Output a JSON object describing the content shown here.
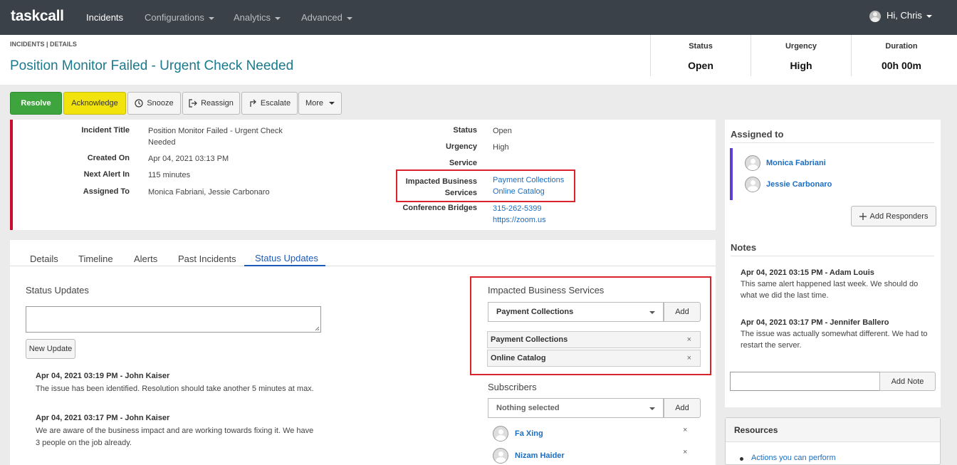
{
  "app": {
    "brand": "taskcall"
  },
  "nav": {
    "items": [
      {
        "label": "Incidents",
        "active": true
      },
      {
        "label": "Configurations",
        "dropdown": true
      },
      {
        "label": "Analytics",
        "dropdown": true
      },
      {
        "label": "Advanced",
        "dropdown": true
      }
    ],
    "user_greeting": "Hi, Chris"
  },
  "header": {
    "breadcrumb": "INCIDENTS | DETAILS",
    "title": "Position Monitor Failed - Urgent Check Needed",
    "stats": [
      {
        "label": "Status",
        "value": "Open"
      },
      {
        "label": "Urgency",
        "value": "High"
      },
      {
        "label": "Duration",
        "value": "00h 00m"
      }
    ]
  },
  "actions": {
    "resolve": "Resolve",
    "acknowledge": "Acknowledge",
    "snooze": "Snooze",
    "reassign": "Reassign",
    "escalate": "Escalate",
    "more": "More"
  },
  "details": {
    "incident_title_label": "Incident Title",
    "incident_title_line1": "Position Monitor Failed - Urgent Check",
    "incident_title_line2": "Needed",
    "created_on_label": "Created On",
    "created_on": "Apr 04, 2021 03:13 PM",
    "next_alert_label": "Next Alert In",
    "next_alert": "115 minutes",
    "assigned_to_label": "Assigned To",
    "assigned_to": "Monica Fabriani, Jessie Carbonaro",
    "status_label": "Status",
    "status": "Open",
    "urgency_label": "Urgency",
    "urgency": "High",
    "service_label": "Service",
    "impacted_label_line1": "Impacted Business",
    "impacted_label_line2": "Services",
    "impacted_services": [
      "Payment Collections",
      "Online Catalog"
    ],
    "conference_label": "Conference Bridges",
    "conference_phone": "315-262-5399",
    "conference_url": "https://zoom.us"
  },
  "tabs": [
    {
      "label": "Details"
    },
    {
      "label": "Timeline"
    },
    {
      "label": "Alerts"
    },
    {
      "label": "Past Incidents"
    },
    {
      "label": "Status Updates",
      "active": true
    }
  ],
  "status_updates": {
    "title": "Status Updates",
    "new_update_button": "New Update",
    "entries": [
      {
        "head": "Apr 04, 2021 03:19 PM - John Kaiser",
        "body_line1": "The issue has been identified. Resolution should take another 5 minutes at max.",
        "body_line2": ""
      },
      {
        "head": "Apr 04, 2021 03:17 PM - John Kaiser",
        "body_line1": "We are aware of the business impact and are working towards fixing it. We have",
        "body_line2": "3 people on the job already."
      }
    ]
  },
  "impacted_panel": {
    "title": "Impacted Business Services",
    "selected": "Payment Collections",
    "add_button": "Add",
    "chips": [
      "Payment Collections",
      "Online Catalog"
    ],
    "remove_glyph": "×"
  },
  "subscribers": {
    "title": "Subscribers",
    "placeholder": "Nothing selected",
    "add_button": "Add",
    "people": [
      "Fa Xing",
      "Nizam Haider"
    ]
  },
  "sidebar": {
    "assigned_title": "Assigned to",
    "assignees": [
      "Monica Fabriani",
      "Jessie Carbonaro"
    ],
    "accent_color": "#5b3fd6",
    "add_responders": "Add Responders",
    "notes_title": "Notes",
    "notes": [
      {
        "head": "Apr 04, 2021 03:15 PM - Adam Louis",
        "line1": "This same alert happened last week. We should do",
        "line2": "what we did the last time."
      },
      {
        "head": "Apr 04, 2021 03:17 PM - Jennifer Ballero",
        "line1": "The issue was actually somewhat different. We had to",
        "line2": "restart the server."
      }
    ],
    "add_note": "Add Note",
    "resources_title": "Resources",
    "resources": [
      "Actions you can perform"
    ]
  },
  "colors": {
    "navbar": "#3a4148",
    "title": "#1a7a8c",
    "resolve": "#3ea53e",
    "acknowledge": "#f2e30c",
    "highlight_box": "#d9232d",
    "link": "#1b6ec2",
    "urgency_bar": "#c8102e"
  }
}
